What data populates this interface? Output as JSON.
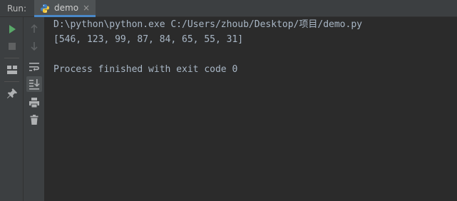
{
  "header": {
    "run_label": "Run:",
    "tab": {
      "icon": "python-icon",
      "label": "demo",
      "close": "×"
    }
  },
  "toolbar_left": [
    {
      "icon": "play-icon",
      "color": "#59a869"
    },
    {
      "icon": "stop-icon",
      "color": "#6e6e6e"
    },
    {
      "icon": "layout-icon",
      "color": "#afb1b3"
    },
    {
      "icon": "pin-icon",
      "color": "#afb1b3"
    }
  ],
  "toolbar_right": [
    {
      "icon": "arrow-up-icon"
    },
    {
      "icon": "arrow-down-icon"
    },
    {
      "icon": "soft-wrap-icon"
    },
    {
      "icon": "scroll-to-end-icon",
      "selected": true
    },
    {
      "icon": "print-icon"
    },
    {
      "icon": "trash-icon"
    }
  ],
  "console": {
    "lines": [
      "D:\\python\\python.exe C:/Users/zhoub/Desktop/项目/demo.py",
      "[546, 123, 99, 87, 84, 65, 55, 31]",
      "",
      "Process finished with exit code 0"
    ]
  },
  "colors": {
    "accent": "#4a88c7",
    "console_bg": "#2b2b2b",
    "panel_bg": "#3c3f41",
    "text": "#a9b7c6"
  }
}
